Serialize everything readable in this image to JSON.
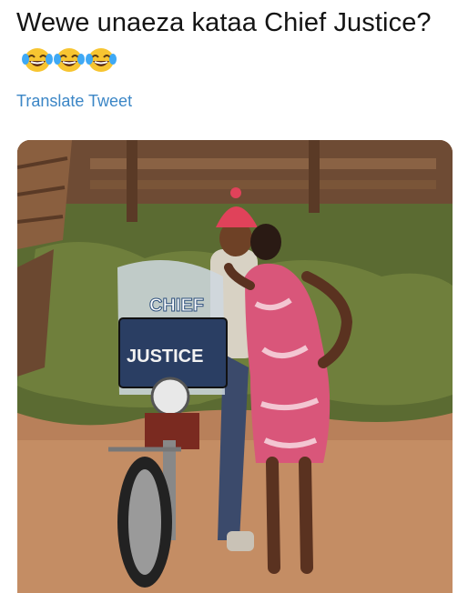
{
  "tweet": {
    "text": "Wewe unaeza kataa Chief Justice?",
    "emojis": [
      "face-with-tears-of-joy",
      "face-with-tears-of-joy",
      "face-with-tears-of-joy"
    ],
    "translate_label": "Translate Tweet"
  },
  "media": {
    "windshield_sticker": "CHIEF",
    "plate_sign": "JUSTICE"
  },
  "colors": {
    "link": "#3b86c6",
    "text": "#141414",
    "emoji_face": "#f7c531"
  }
}
